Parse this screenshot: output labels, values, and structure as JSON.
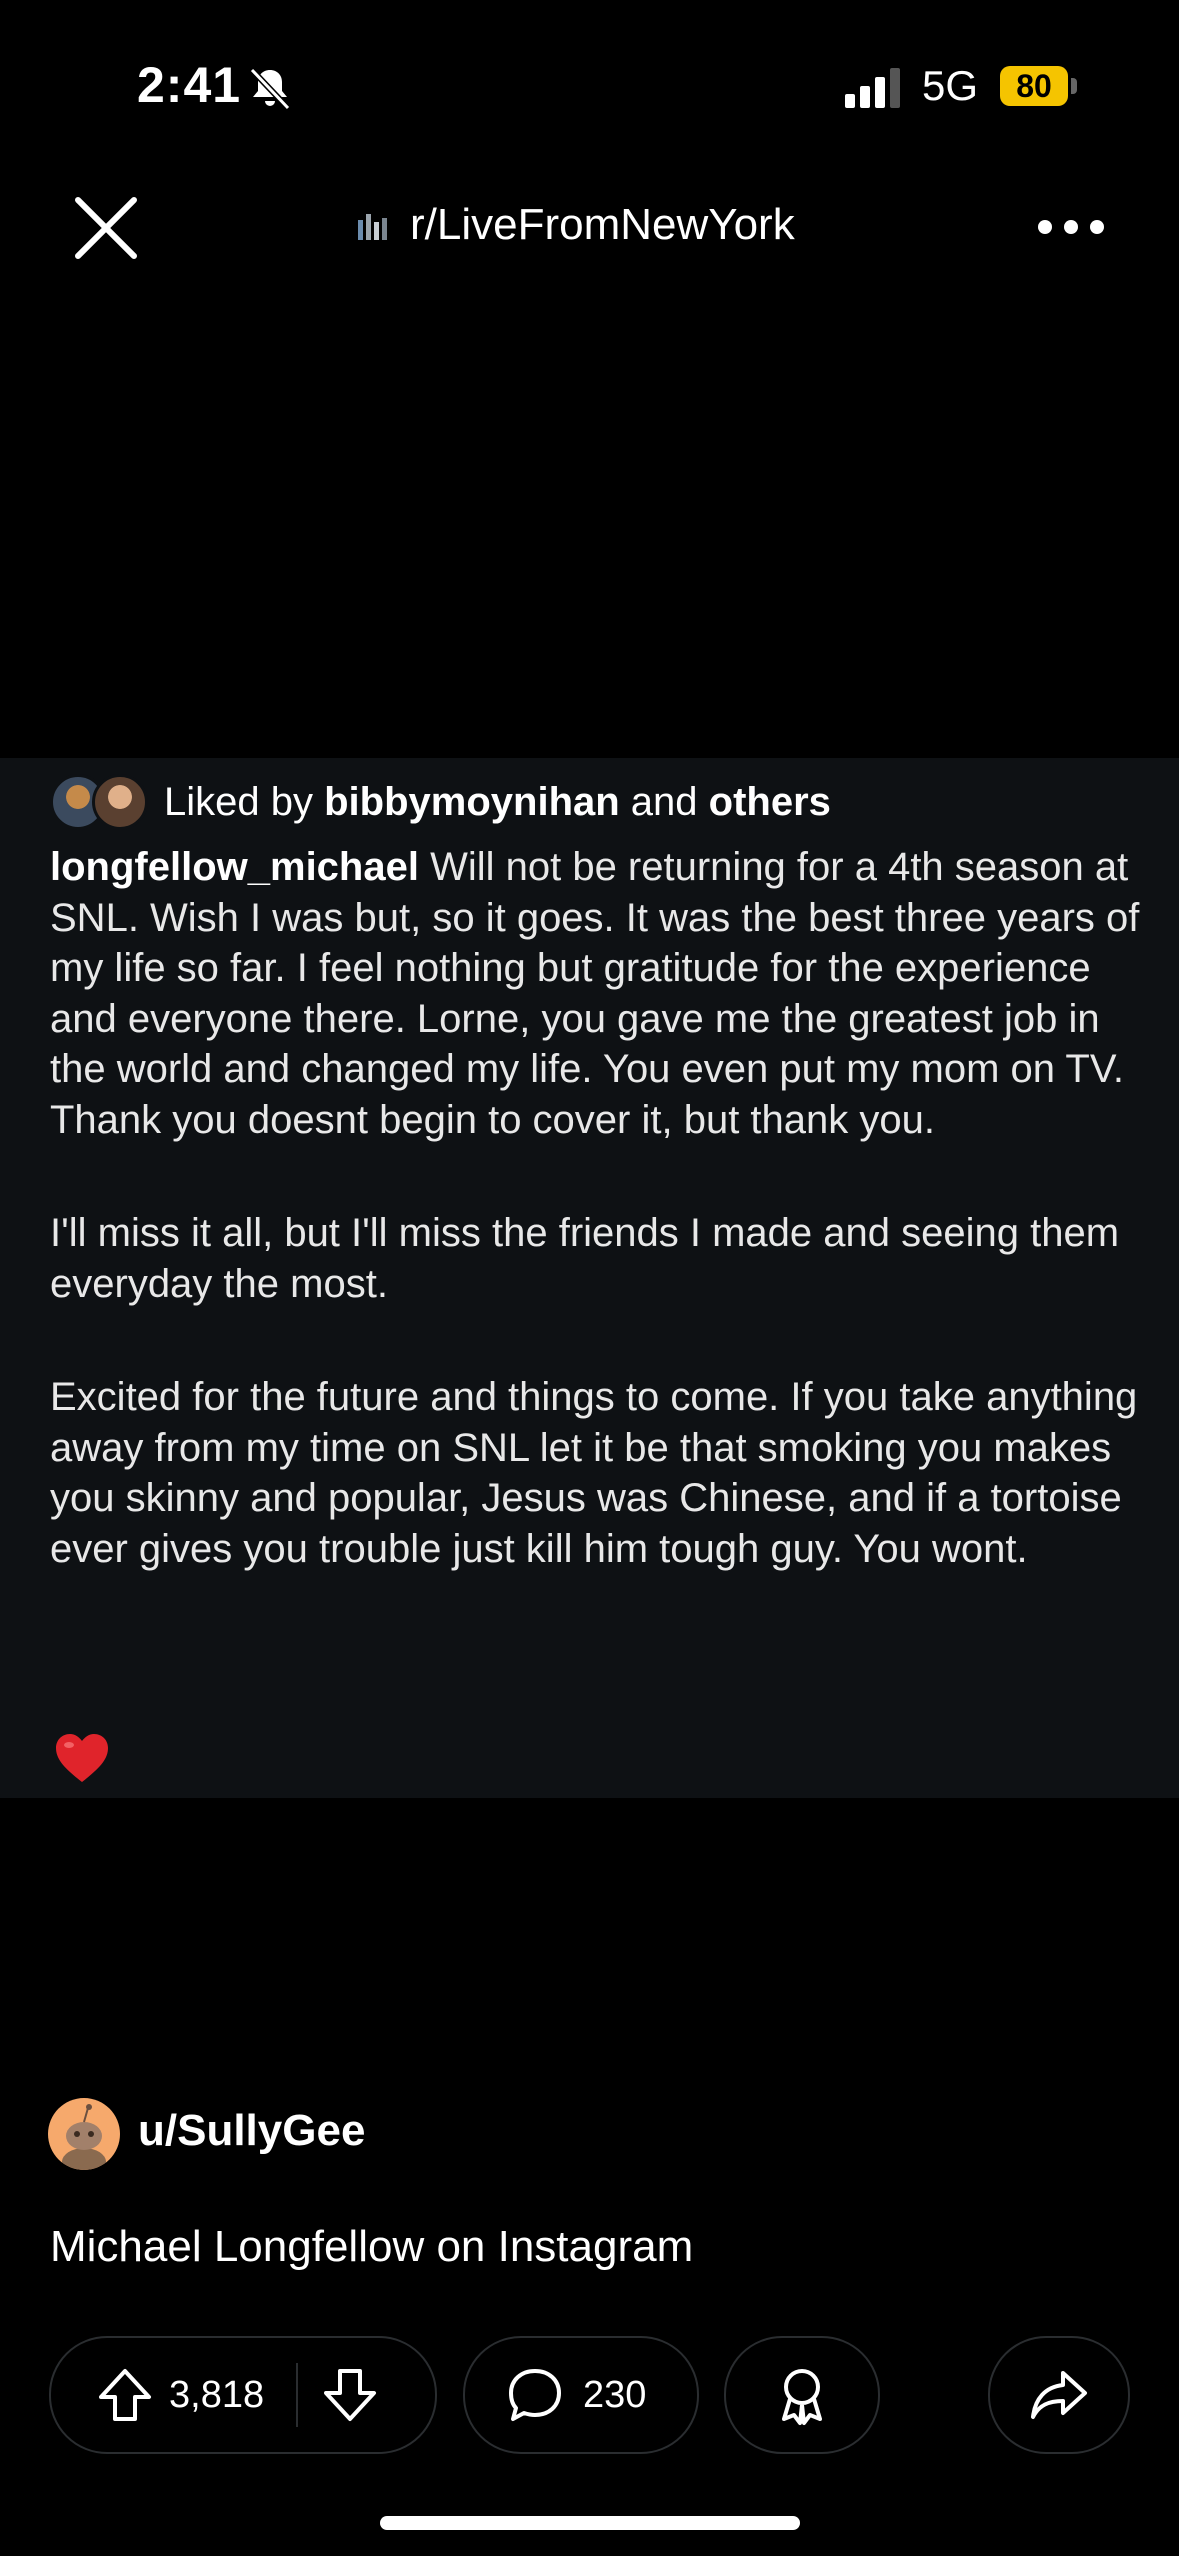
{
  "status_bar": {
    "time": "2:41",
    "network": "5G",
    "battery": "80"
  },
  "header": {
    "subreddit": "r/LiveFromNewYork"
  },
  "caption_panel": {
    "liked_prefix": "Liked by ",
    "liked_user": "bibbymoynihan",
    "liked_mid": " and ",
    "liked_others": "others",
    "username": "longfellow_michael",
    "paragraph_1": " Will not be returning for a 4th season at SNL. Wish I was but, so it goes. It was the best three years of my life so far. I feel nothing but gratitude for the experience and everyone there. Lorne, you gave me the greatest job in the world and changed my life. You even put my mom on TV. Thank you doesnt begin to cover it, but thank you.",
    "paragraph_2": "I'll miss it all, but I'll miss the friends I made and seeing them everyday the most.",
    "paragraph_3": "Excited for the future and things to come. If you take anything away from my time on SNL let it be that smoking you makes you skinny and popular, Jesus was Chinese, and if a tortoise ever gives you trouble just kill him tough guy. You wont."
  },
  "post": {
    "author": "u/SullyGee",
    "title": "Michael Longfellow on Instagram",
    "upvotes": "3,818",
    "comments": "230"
  },
  "colors": {
    "background": "#000000",
    "panel": "#0e1114",
    "battery": "#f5c400",
    "avatar": "#f6a96c",
    "heart": "#e0242b"
  }
}
